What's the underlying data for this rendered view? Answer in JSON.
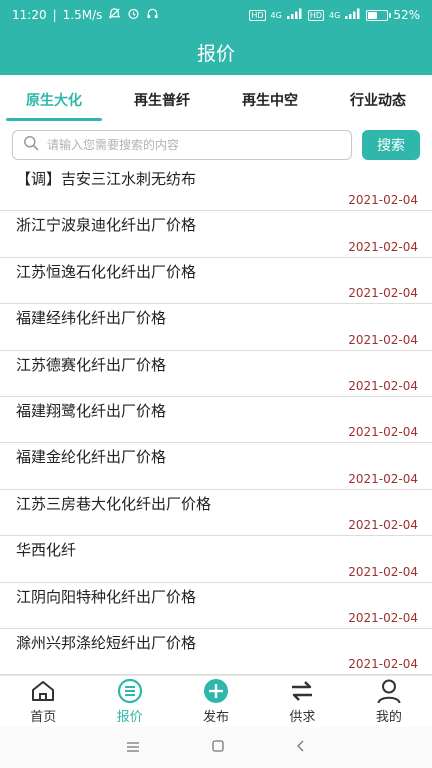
{
  "status_bar": {
    "time": "11:20",
    "net_speed": "1.5M/s",
    "net_type_1": "HD",
    "signal_1": "4G",
    "net_type_2": "HD",
    "signal_2": "4G",
    "battery_percent": "52%",
    "battery_level": 0.52
  },
  "header": {
    "title": "报价"
  },
  "tabs": [
    {
      "label": "原生大化",
      "active": true
    },
    {
      "label": "再生普纤",
      "active": false
    },
    {
      "label": "再生中空",
      "active": false
    },
    {
      "label": "行业动态",
      "active": false
    }
  ],
  "search": {
    "placeholder": "请输入您需要搜索的内容",
    "value": "",
    "button_label": "搜索"
  },
  "list": [
    {
      "title": "【调】吉安三江水刺无纺布",
      "date": "2021-02-04"
    },
    {
      "title": "浙江宁波泉迪化纤出厂价格",
      "date": "2021-02-04"
    },
    {
      "title": "江苏恒逸石化化纤出厂价格",
      "date": "2021-02-04"
    },
    {
      "title": "福建经纬化纤出厂价格",
      "date": "2021-02-04"
    },
    {
      "title": "江苏德赛化纤出厂价格",
      "date": "2021-02-04"
    },
    {
      "title": "福建翔鹭化纤出厂价格",
      "date": "2021-02-04"
    },
    {
      "title": "福建金纶化纤出厂价格",
      "date": "2021-02-04"
    },
    {
      "title": "江苏三房巷大化化纤出厂价格",
      "date": "2021-02-04"
    },
    {
      "title": "华西化纤",
      "date": "2021-02-04"
    },
    {
      "title": "江阴向阳特种化纤出厂价格",
      "date": "2021-02-04"
    },
    {
      "title": "滁州兴邦涤纶短纤出厂价格",
      "date": "2021-02-04"
    }
  ],
  "bottom_nav": [
    {
      "label": "首页",
      "icon": "home-icon",
      "active": false
    },
    {
      "label": "报价",
      "icon": "list-icon",
      "active": true
    },
    {
      "label": "发布",
      "icon": "plus-icon",
      "active": false
    },
    {
      "label": "供求",
      "icon": "swap-icon",
      "active": false
    },
    {
      "label": "我的",
      "icon": "user-icon",
      "active": false
    }
  ],
  "colors": {
    "accent": "#2fb7ab",
    "date": "#a03030",
    "text": "#222222"
  }
}
